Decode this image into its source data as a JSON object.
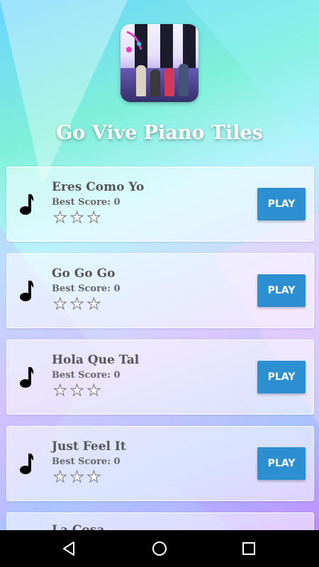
{
  "app": {
    "title": "Go Vive Piano Tiles"
  },
  "songs": [
    {
      "name": "Eres Como Yo",
      "best_score": "Best Score: 0",
      "stars": 0,
      "play_label": "PLAY"
    },
    {
      "name": "Go Go Go",
      "best_score": "Best Score: 0",
      "stars": 0,
      "play_label": "PLAY"
    },
    {
      "name": "Hola Que Tal",
      "best_score": "Best Score: 0",
      "stars": 0,
      "play_label": "PLAY"
    },
    {
      "name": "Just Feel It",
      "best_score": "Best Score: 0",
      "stars": 0,
      "play_label": "PLAY"
    },
    {
      "name": "La Cosa",
      "best_score": "",
      "stars": 0,
      "play_label": ""
    }
  ],
  "icons": {
    "song": "music-note-icon",
    "star": "star-outline-icon",
    "nav_back": "back-triangle-icon",
    "nav_home": "home-circle-icon",
    "nav_recents": "recents-square-icon"
  },
  "colors": {
    "play_button": "#2b8fd0",
    "title": "#ffffff",
    "navbar": "#000000"
  }
}
